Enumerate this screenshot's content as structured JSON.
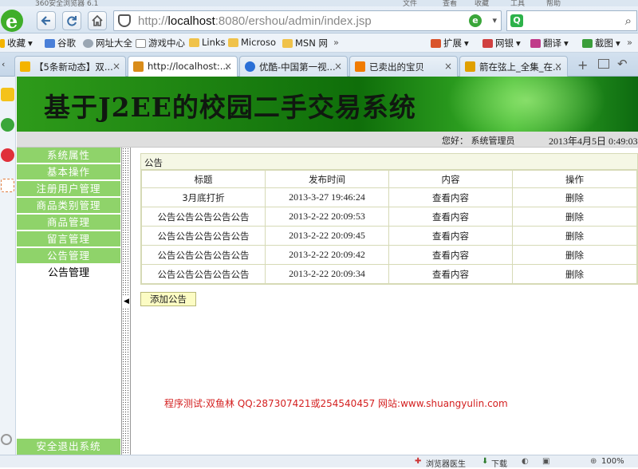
{
  "window": {
    "title": "360安全浏览器 6.1",
    "menus": [
      "文件",
      "查看",
      "收藏",
      "工具",
      "帮助"
    ]
  },
  "address_bar": {
    "host_dim": "http://",
    "host": "localhost",
    "path": ":8080/ershou/admin/index.jsp"
  },
  "favorites": {
    "items": [
      {
        "label": "收藏",
        "icon": "star-icon"
      },
      {
        "label": "谷歌",
        "icon": "google-icon"
      },
      {
        "label": "网址大全",
        "icon": "globe-icon"
      },
      {
        "label": "游戏中心",
        "icon": "page-icon"
      },
      {
        "label": "Links",
        "icon": "folder-icon"
      },
      {
        "label": "Microso",
        "icon": "folder-icon"
      },
      {
        "label": "MSN 网",
        "icon": "folder-icon"
      },
      {
        "label": "»",
        "icon": ""
      }
    ],
    "tools": [
      "扩展",
      "网银",
      "翻译",
      "截图",
      "»"
    ]
  },
  "tabs": [
    {
      "label": "【5条新动态】双...",
      "active": false,
      "color": "#f4b400"
    },
    {
      "label": "http://localhost:...",
      "active": true,
      "color": "#d98c1a"
    },
    {
      "label": "优酷-中国第一视...",
      "active": false,
      "color": "#2a6fd6"
    },
    {
      "label": "已卖出的宝贝",
      "active": false,
      "color": "#f07b00"
    },
    {
      "label": "箭在弦上_全集_在...",
      "active": false,
      "color": "#e0a000"
    }
  ],
  "banner": {
    "title": "基于J2EE的校园二手交易系统"
  },
  "userbar": {
    "greeting": "您好： 系统管理员",
    "datetime": "2013年4月5日  0:49:03"
  },
  "menu": {
    "items": [
      "系统属性",
      "基本操作",
      "注册用户管理",
      "商品类别管理",
      "商品管理",
      "留言管理",
      "公告管理"
    ],
    "active_sub": "公告管理",
    "exit": "安全退出系统"
  },
  "panel": {
    "title": "公告",
    "columns": [
      "标题",
      "发布时间",
      "内容",
      "操作"
    ],
    "rows": [
      {
        "title": "3月底打折",
        "date": "2013-3-27 19:46:24",
        "content": "查看内容",
        "action": "删除"
      },
      {
        "title": "公告公告公告公告公告",
        "date": "2013-2-22 20:09:53",
        "content": "查看内容",
        "action": "删除"
      },
      {
        "title": "公告公告公告公告公告",
        "date": "2013-2-22 20:09:45",
        "content": "查看内容",
        "action": "删除"
      },
      {
        "title": "公告公告公告公告公告",
        "date": "2013-2-22 20:09:42",
        "content": "查看内容",
        "action": "删除"
      },
      {
        "title": "公告公告公告公告公告",
        "date": "2013-2-22 20:09:34",
        "content": "查看内容",
        "action": "删除"
      }
    ],
    "add_button": "添加公告"
  },
  "credit": "程序测试:双鱼林 QQ:287307421或254540457 网站:www.shuangyulin.com",
  "status": {
    "doctor": "浏览器医生",
    "download": "下载",
    "zoom": "100%"
  },
  "colors": {
    "menu_green": "#8fd36a",
    "banner_green": "#1a7a12",
    "credit_red": "#d42020"
  }
}
